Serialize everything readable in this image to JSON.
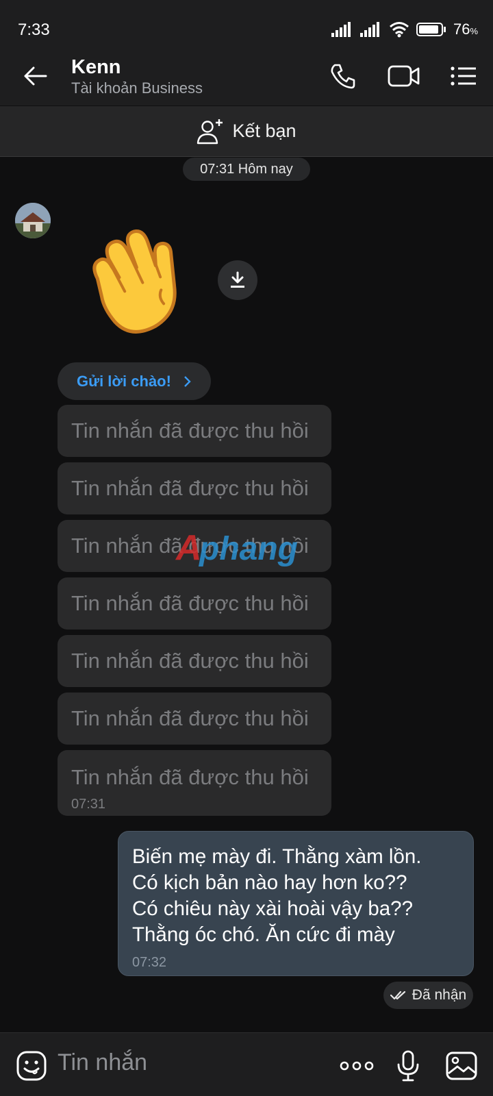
{
  "status_bar": {
    "time": "7:33",
    "battery_percent": "76",
    "battery_unit": "%",
    "battery_level": 0.76
  },
  "header": {
    "contact_name": "Kenn",
    "contact_subtitle": "Tài khoản Business",
    "icons": [
      "back-arrow-icon",
      "phone-icon",
      "video-call-icon",
      "menu-list-icon"
    ]
  },
  "friend_bar": {
    "label": "Kết bạn",
    "icon": "add-friend-icon"
  },
  "conversation": {
    "date_divider": "07:31 Hôm nay",
    "sticker": "waving-hand-sticker",
    "greet_chip": "Gửi lời chào!",
    "recalled_messages": [
      "Tin nhắn đã được thu hồi",
      "Tin nhắn đã được thu hồi",
      "Tin nhắn đã được thu hồi",
      "Tin nhắn đã được thu hồi",
      "Tin nhắn đã được thu hồi",
      "Tin nhắn đã được thu hồi",
      "Tin nhắn đã được thu hồi"
    ],
    "recalled_time": "07:31",
    "outgoing": {
      "lines": [
        "Biến mẹ mày đi.  Thằng xàm lồn.",
        "Có kịch bản nào hay hơn ko??",
        "Có chiêu này xài hoài vậy ba??",
        "Thằng óc chó. Ăn cức đi mày"
      ],
      "time": "07:32"
    },
    "delivery_status": "Đã nhận",
    "watermark": "Aphang"
  },
  "composer": {
    "placeholder": "Tin nhắn"
  },
  "colors": {
    "accent_blue": "#3b9cf5",
    "outgoing_bubble": "#384450",
    "background": "#0f0f10"
  }
}
